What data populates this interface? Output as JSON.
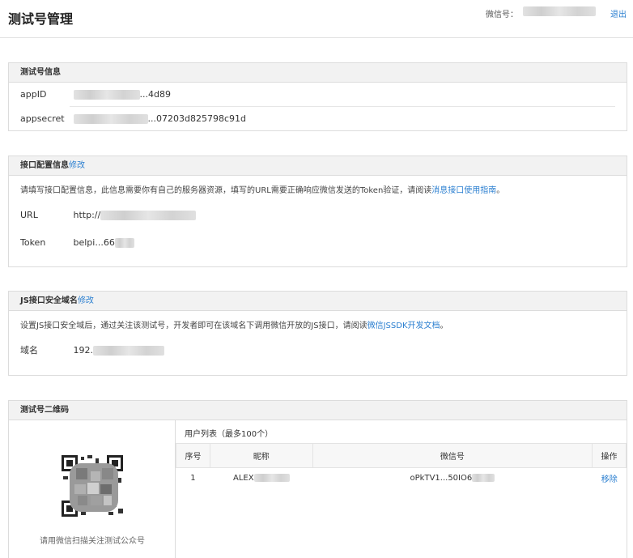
{
  "header": {
    "title": "测试号管理",
    "wechat_label": "微信号：",
    "logout": "退出"
  },
  "test_info": {
    "title": "测试号信息",
    "appid_label": "appID",
    "appid_value_visible": "...4d89",
    "appsecret_label": "appsecret",
    "appsecret_value_visible": "...07203d825798c91d"
  },
  "api_config": {
    "title": "接口配置信息",
    "edit": "修改",
    "desc_prefix": "请填写接口配置信息，此信息需要你有自己的服务器资源，填写的URL需要正确响应微信发送的Token验证，请阅读",
    "desc_link": "消息接口使用指南",
    "desc_suffix": "。",
    "url_label": "URL",
    "url_value_visible": "http://",
    "token_label": "Token",
    "token_value_visible": "belpi...66"
  },
  "js_domain": {
    "title": "JS接口安全域名",
    "edit": "修改",
    "desc_prefix": "设置JS接口安全域后，通过关注该测试号，开发者即可在该域名下调用微信开放的JS接口，请阅读",
    "desc_link": "微信JSSDK开发文档",
    "desc_suffix": "。",
    "domain_label": "域名",
    "domain_value_visible": "192."
  },
  "qr": {
    "title": "测试号二维码",
    "caption": "请用微信扫描关注测试公众号",
    "userlist_title": "用户列表（最多100个）",
    "columns": [
      "序号",
      "昵称",
      "微信号",
      "操作"
    ],
    "rows": [
      {
        "index": "1",
        "nickname": "ALEX",
        "wechat_id": "oPkTV1...50IO6",
        "action": "移除"
      }
    ]
  }
}
